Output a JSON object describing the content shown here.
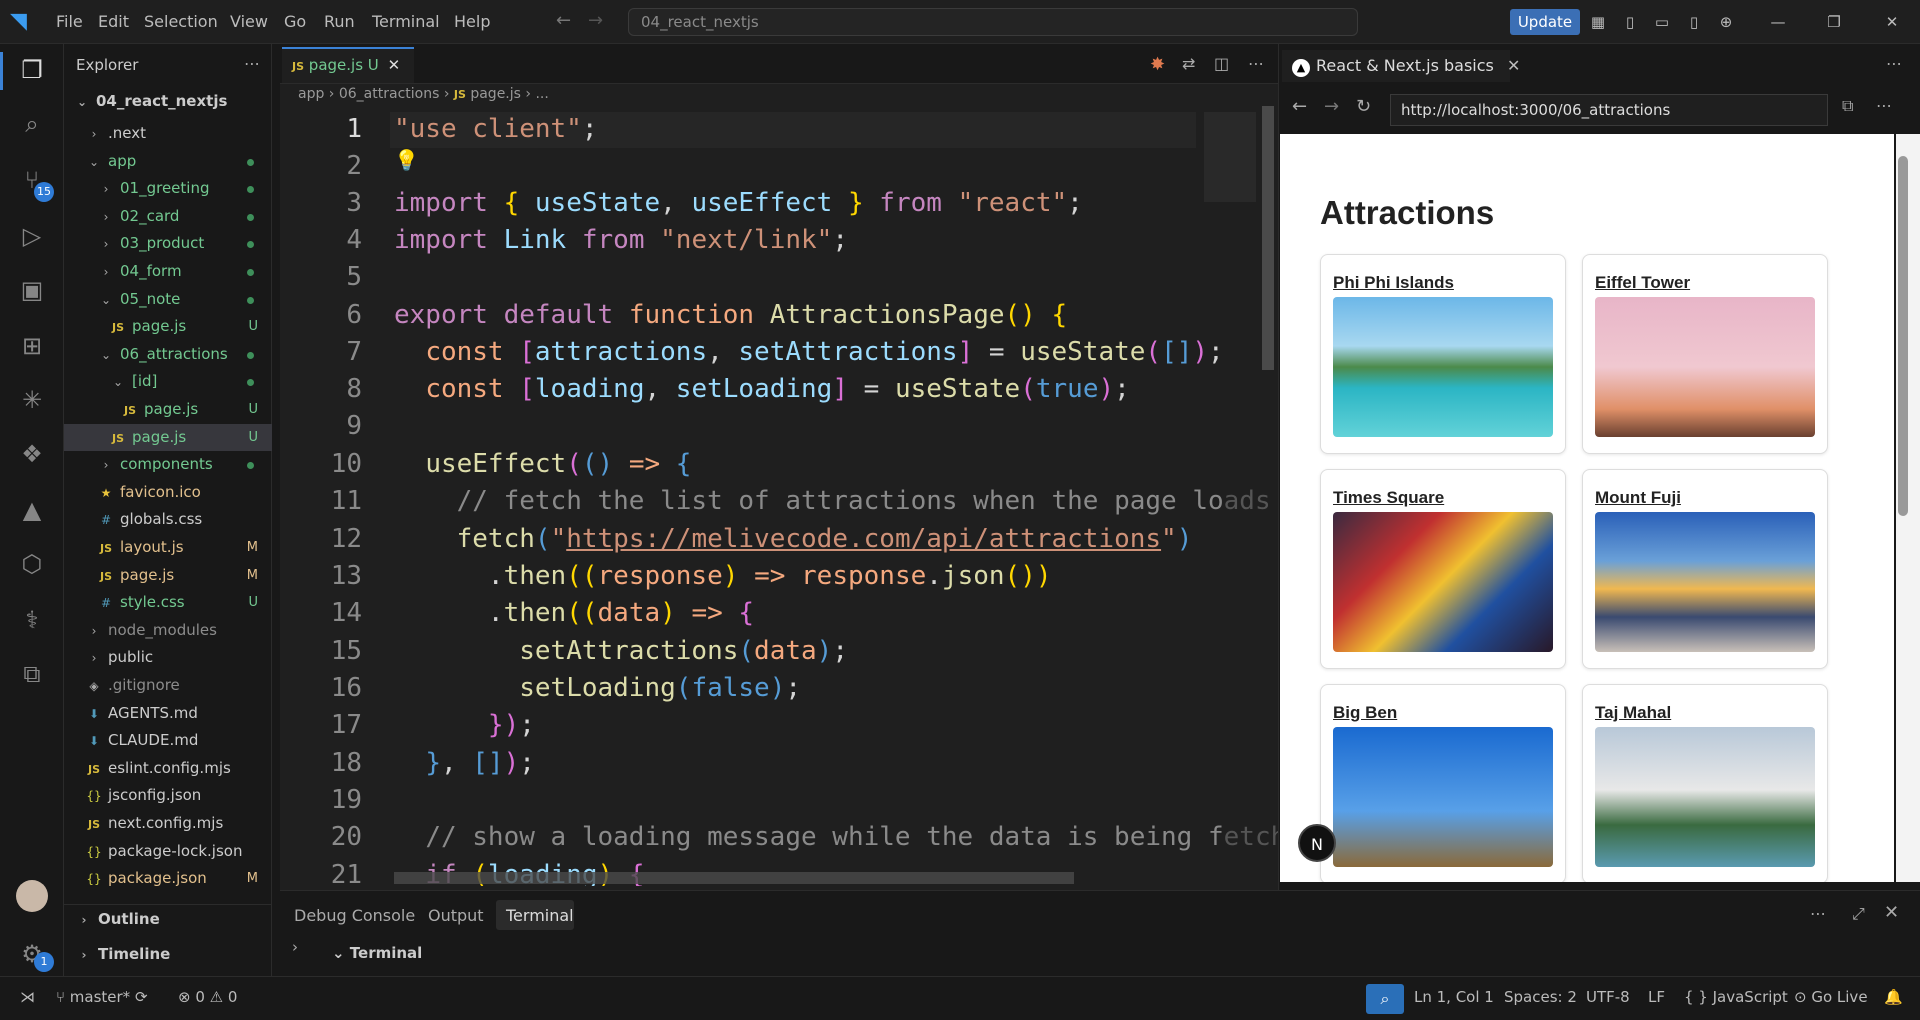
{
  "menu": [
    "File",
    "Edit",
    "Selection",
    "View",
    "Go",
    "Run",
    "Terminal",
    "Help"
  ],
  "command_center": "04_react_nextjs",
  "update_label": "Update",
  "scm_badge": "15",
  "settings_badge": "1",
  "explorer": {
    "title": "Explorer",
    "root": "04_react_nextjs",
    "items": [
      {
        "label": ".next",
        "indent": 1,
        "type": "folder",
        "open": false
      },
      {
        "label": "app",
        "indent": 1,
        "type": "folder",
        "open": true,
        "dot": true,
        "color": "g"
      },
      {
        "label": "01_greeting",
        "indent": 2,
        "type": "folder",
        "open": false,
        "dot": true,
        "color": "g"
      },
      {
        "label": "02_card",
        "indent": 2,
        "type": "folder",
        "open": false,
        "dot": true,
        "color": "g"
      },
      {
        "label": "03_product",
        "indent": 2,
        "type": "folder",
        "open": false,
        "dot": true,
        "color": "g"
      },
      {
        "label": "04_form",
        "indent": 2,
        "type": "folder",
        "open": false,
        "dot": true,
        "color": "g"
      },
      {
        "label": "05_note",
        "indent": 2,
        "type": "folder",
        "open": true,
        "dot": true,
        "color": "g"
      },
      {
        "label": "page.js",
        "indent": 3,
        "type": "js",
        "git": "U",
        "color": "g"
      },
      {
        "label": "06_attractions",
        "indent": 2,
        "type": "folder",
        "open": true,
        "dot": true,
        "color": "g"
      },
      {
        "label": "[id]",
        "indent": 3,
        "type": "folder",
        "open": true,
        "dot": true,
        "color": "g"
      },
      {
        "label": "page.js",
        "indent": 4,
        "type": "js",
        "git": "U",
        "color": "g"
      },
      {
        "label": "page.js",
        "indent": 3,
        "type": "js",
        "git": "U",
        "color": "g",
        "selected": true
      },
      {
        "label": "components",
        "indent": 2,
        "type": "folder",
        "open": false,
        "dot": true,
        "color": "g"
      },
      {
        "label": "favicon.ico",
        "indent": 2,
        "type": "star",
        "color": "y"
      },
      {
        "label": "globals.css",
        "indent": 2,
        "type": "css",
        "color": ""
      },
      {
        "label": "layout.js",
        "indent": 2,
        "type": "js",
        "git": "M",
        "color": "y"
      },
      {
        "label": "page.js",
        "indent": 2,
        "type": "js",
        "git": "M",
        "color": "y"
      },
      {
        "label": "style.css",
        "indent": 2,
        "type": "css",
        "git": "U",
        "color": "g"
      },
      {
        "label": "node_modules",
        "indent": 1,
        "type": "folder",
        "open": false,
        "color": "dim"
      },
      {
        "label": "public",
        "indent": 1,
        "type": "folder",
        "open": false,
        "color": ""
      },
      {
        "label": ".gitignore",
        "indent": 1,
        "type": "git",
        "color": "dim"
      },
      {
        "label": "AGENTS.md",
        "indent": 1,
        "type": "md",
        "color": ""
      },
      {
        "label": "CLAUDE.md",
        "indent": 1,
        "type": "md",
        "color": ""
      },
      {
        "label": "eslint.config.mjs",
        "indent": 1,
        "type": "js",
        "color": ""
      },
      {
        "label": "jsconfig.json",
        "indent": 1,
        "type": "json",
        "color": ""
      },
      {
        "label": "next.config.mjs",
        "indent": 1,
        "type": "js",
        "color": ""
      },
      {
        "label": "package-lock.json",
        "indent": 1,
        "type": "json",
        "color": ""
      },
      {
        "label": "package.json",
        "indent": 1,
        "type": "json",
        "git": "M",
        "color": "y"
      }
    ],
    "outline": "Outline",
    "timeline": "Timeline"
  },
  "editor": {
    "tab_label": "page.js",
    "tab_status": "U",
    "breadcrumb": [
      "app",
      "06_attractions",
      "page.js",
      "..."
    ],
    "line_numbers": [
      "1",
      "2",
      "3",
      "4",
      "5",
      "6",
      "7",
      "8",
      "9",
      "10",
      "11",
      "12",
      "13",
      "14",
      "15",
      "16",
      "17",
      "18",
      "19",
      "20",
      "21"
    ]
  },
  "browser": {
    "tab_title": "React & Next.js basics",
    "url": "http://localhost:3000/06_attractions",
    "page_title": "Attractions",
    "cards": [
      "Phi Phi Islands",
      "Eiffel Tower",
      "Times Square",
      "Mount Fuji",
      "Big Ben",
      "Taj Mahal"
    ],
    "next_badge": "N"
  },
  "panel": {
    "tabs": [
      "Debug Console",
      "Output",
      "Terminal"
    ],
    "active": "Terminal",
    "section": "Terminal"
  },
  "status": {
    "branch": "master*",
    "errors": "0",
    "warnings": "0",
    "position": "Ln 1, Col 1",
    "spaces": "Spaces: 2",
    "encoding": "UTF-8",
    "eol": "LF",
    "language": "JavaScript",
    "golive": "Go Live"
  }
}
